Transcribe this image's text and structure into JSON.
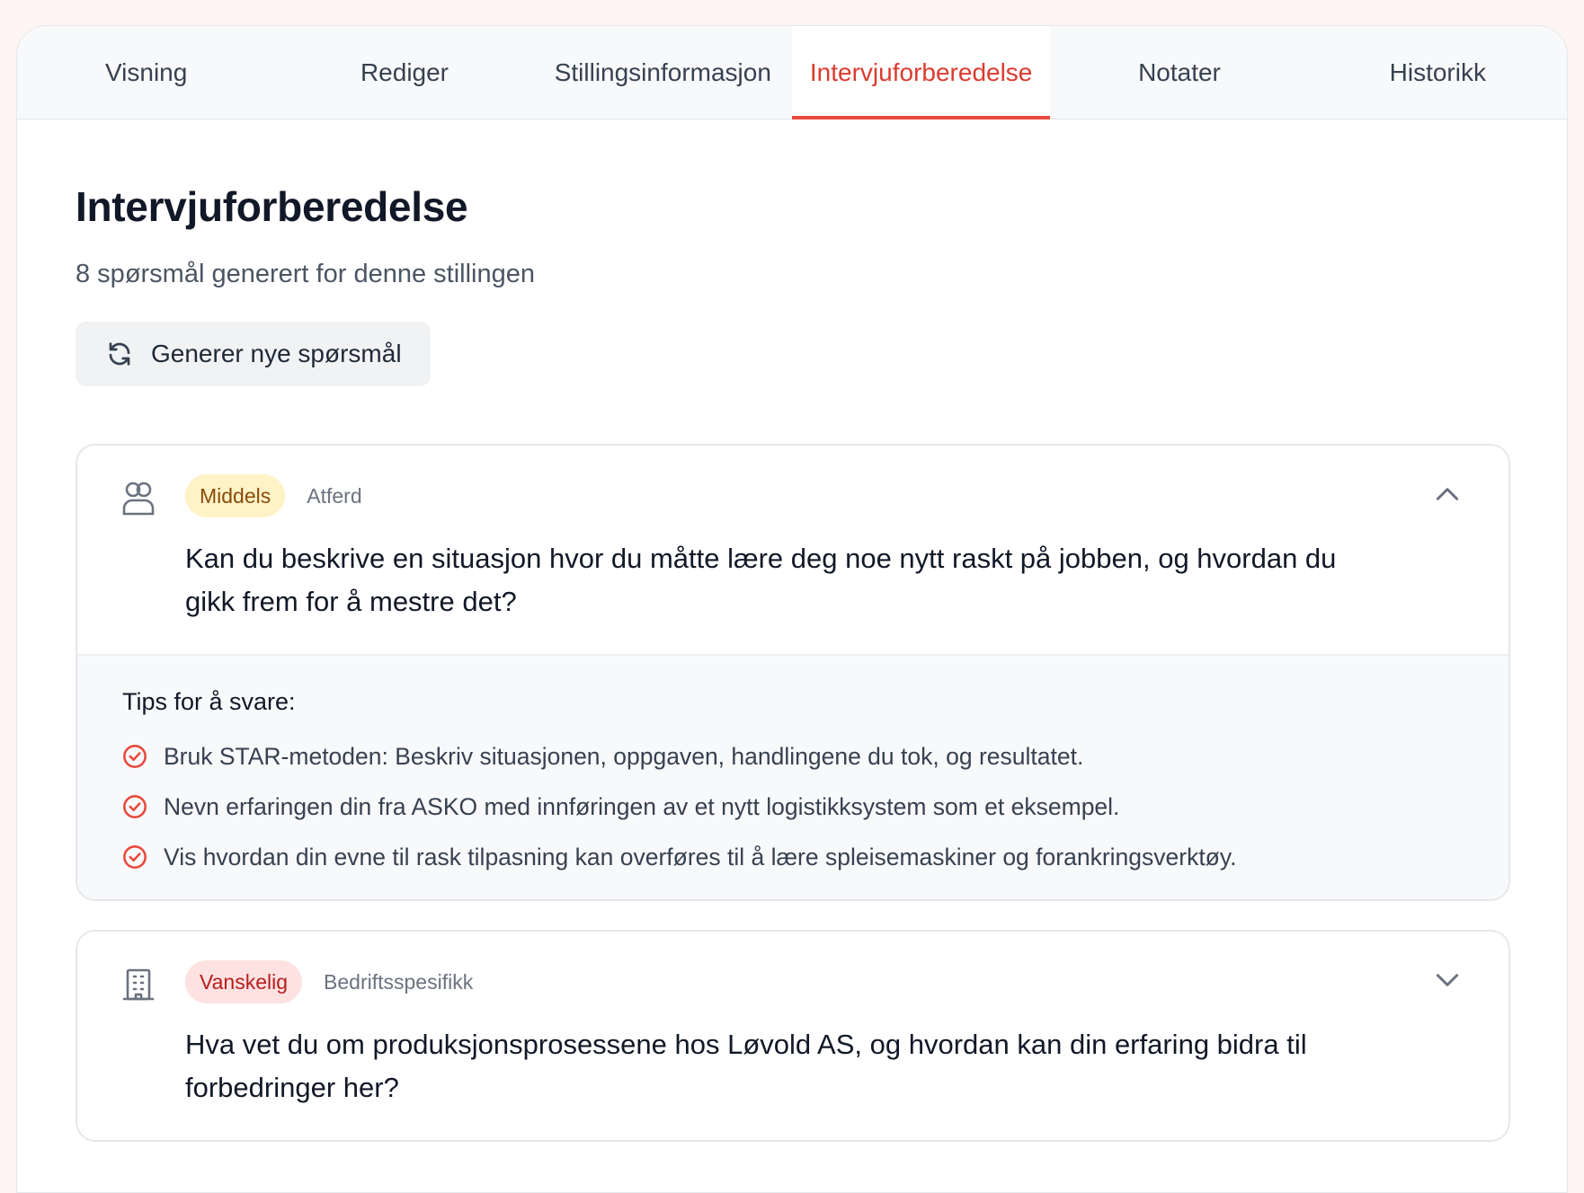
{
  "tabs": [
    {
      "label": "Visning",
      "active": false
    },
    {
      "label": "Rediger",
      "active": false
    },
    {
      "label": "Stillingsinformasjon",
      "active": false
    },
    {
      "label": "Intervjuforberedelse",
      "active": true
    },
    {
      "label": "Notater",
      "active": false
    },
    {
      "label": "Historikk",
      "active": false
    }
  ],
  "page": {
    "title": "Intervjuforberedelse",
    "subtitle": "8 spørsmål generert for denne stillingen",
    "regenerate_label": "Generer nye spørsmål",
    "regenerate_icon": "refresh-icon"
  },
  "questions": [
    {
      "icon": "users-icon",
      "difficulty": "Middels",
      "category": "Atferd",
      "text": "Kan du beskrive en situasjon hvor du måtte lære deg noe nytt raskt på jobben, og hvordan du gikk frem for å mestre det?",
      "expanded": true,
      "tips_title": "Tips for å svare:",
      "tips": [
        "Bruk STAR-metoden: Beskriv situasjonen, oppgaven, handlingene du tok, og resultatet.",
        "Nevn erfaringen din fra ASKO med innføringen av et nytt logistikksystem som et eksempel.",
        "Vis hvordan din evne til rask tilpasning kan overføres til å lære spleisemaskiner og forankringsverktøy."
      ]
    },
    {
      "icon": "building-icon",
      "difficulty": "Vanskelig",
      "category": "Bedriftsspesifikk",
      "text": "Hva vet du om produksjonsprosessene hos Løvold AS, og hvordan kan din erfaring bidra til forbedringer her?",
      "expanded": false
    }
  ],
  "colors": {
    "accent": "#e8493d",
    "middels_bg": "#fef3c7",
    "vanskelig_bg": "#fee2e2"
  }
}
